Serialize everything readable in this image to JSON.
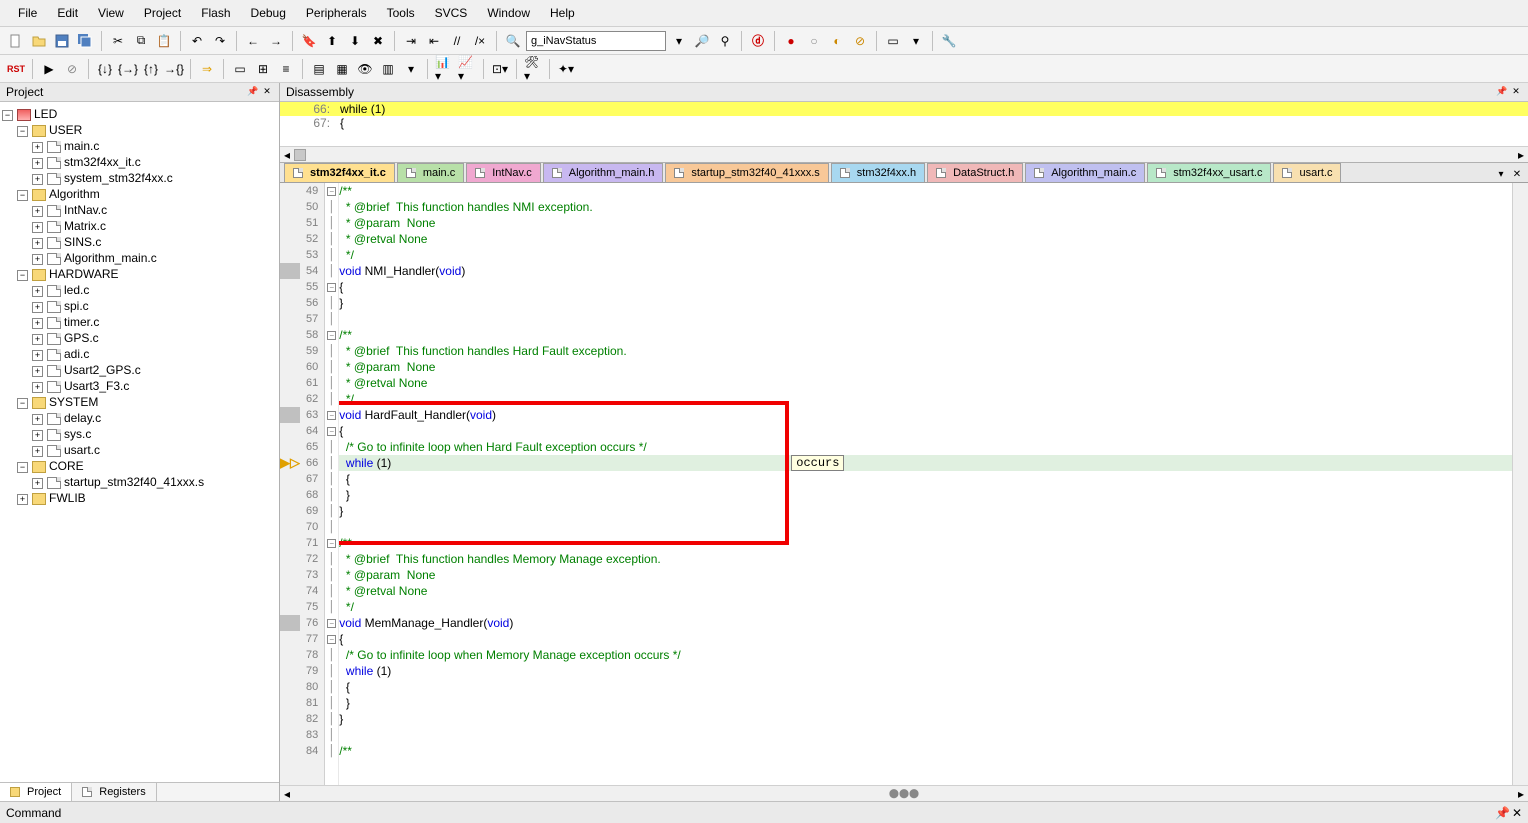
{
  "menubar": [
    "File",
    "Edit",
    "View",
    "Project",
    "Flash",
    "Debug",
    "Peripherals",
    "Tools",
    "SVCS",
    "Window",
    "Help"
  ],
  "search_value": "g_iNavStatus",
  "panes": {
    "project_title": "Project",
    "disasm_title": "Disassembly",
    "command_title": "Command"
  },
  "bottom_tabs": [
    {
      "label": "Project",
      "active": true
    },
    {
      "label": "Registers",
      "active": false
    }
  ],
  "tree": {
    "root": "LED",
    "groups": [
      {
        "name": "USER",
        "files": [
          "main.c",
          "stm32f4xx_it.c",
          "system_stm32f4xx.c"
        ]
      },
      {
        "name": "Algorithm",
        "files": [
          "IntNav.c",
          "Matrix.c",
          "SINS.c",
          "Algorithm_main.c"
        ]
      },
      {
        "name": "HARDWARE",
        "files": [
          "led.c",
          "spi.c",
          "timer.c",
          "GPS.c",
          "adi.c",
          "Usart2_GPS.c",
          "Usart3_F3.c"
        ]
      },
      {
        "name": "SYSTEM",
        "files": [
          "delay.c",
          "sys.c",
          "usart.c"
        ]
      },
      {
        "name": "CORE",
        "files": [
          "startup_stm32f40_41xxx.s"
        ]
      },
      {
        "name": "FWLIB",
        "files": []
      }
    ]
  },
  "disasm": [
    {
      "num": "66:",
      "text": "   while (1)",
      "hl": true
    },
    {
      "num": "67:",
      "text": "   {",
      "hl": false
    }
  ],
  "editor_tabs": [
    {
      "label": "stm32f4xx_it.c",
      "cls": "c0",
      "active": true
    },
    {
      "label": "main.c",
      "cls": "c1",
      "active": false
    },
    {
      "label": "IntNav.c",
      "cls": "c2",
      "active": false
    },
    {
      "label": "Algorithm_main.h",
      "cls": "c3",
      "active": false
    },
    {
      "label": "startup_stm32f40_41xxx.s",
      "cls": "c4",
      "active": false
    },
    {
      "label": "stm32f4xx.h",
      "cls": "c5",
      "active": false
    },
    {
      "label": "DataStruct.h",
      "cls": "c6",
      "active": false
    },
    {
      "label": "Algorithm_main.c",
      "cls": "c7",
      "active": false
    },
    {
      "label": "stm32f4xx_usart.c",
      "cls": "c8",
      "active": false
    },
    {
      "label": "usart.c",
      "cls": "c9",
      "active": false
    }
  ],
  "tooltip": "occurs",
  "code": {
    "start": 49,
    "current_line": 66,
    "breakpoint_lines": [
      54,
      63,
      76
    ],
    "fold_minus": [
      49,
      55,
      58,
      63,
      64,
      71,
      76,
      77
    ],
    "lines": [
      {
        "n": 49,
        "html": "<span class='cm'>/**</span>"
      },
      {
        "n": 50,
        "html": "<span class='cm'>  * @brief  This function handles NMI exception.</span>"
      },
      {
        "n": 51,
        "html": "<span class='cm'>  * @param  None</span>"
      },
      {
        "n": 52,
        "html": "<span class='cm'>  * @retval None</span>"
      },
      {
        "n": 53,
        "html": "<span class='cm'>  */</span>"
      },
      {
        "n": 54,
        "html": "<span class='kw'>void</span> NMI_Handler(<span class='kw'>void</span>)"
      },
      {
        "n": 55,
        "html": "{"
      },
      {
        "n": 56,
        "html": "}"
      },
      {
        "n": 57,
        "html": ""
      },
      {
        "n": 58,
        "html": "<span class='cm'>/**</span>"
      },
      {
        "n": 59,
        "html": "<span class='cm'>  * @brief  This function handles Hard Fault exception.</span>"
      },
      {
        "n": 60,
        "html": "<span class='cm'>  * @param  None</span>"
      },
      {
        "n": 61,
        "html": "<span class='cm'>  * @retval None</span>"
      },
      {
        "n": 62,
        "html": "<span class='cm'>  */</span>"
      },
      {
        "n": 63,
        "html": "<span class='kw'>void</span> HardFault_Handler(<span class='kw'>void</span>)"
      },
      {
        "n": 64,
        "html": "{"
      },
      {
        "n": 65,
        "html": "  <span class='cm'>/* Go to infinite loop when Hard Fault exception occurs */</span>"
      },
      {
        "n": 66,
        "html": "  <span class='kw'>while</span> (1)",
        "hl": true
      },
      {
        "n": 67,
        "html": "  {"
      },
      {
        "n": 68,
        "html": "  }"
      },
      {
        "n": 69,
        "html": "}"
      },
      {
        "n": 70,
        "html": ""
      },
      {
        "n": 71,
        "html": "<span class='cm'>/**</span>"
      },
      {
        "n": 72,
        "html": "<span class='cm'>  * @brief  This function handles Memory Manage exception.</span>"
      },
      {
        "n": 73,
        "html": "<span class='cm'>  * @param  None</span>"
      },
      {
        "n": 74,
        "html": "<span class='cm'>  * @retval None</span>"
      },
      {
        "n": 75,
        "html": "<span class='cm'>  */</span>"
      },
      {
        "n": 76,
        "html": "<span class='kw'>void</span> MemManage_Handler(<span class='kw'>void</span>)"
      },
      {
        "n": 77,
        "html": "{"
      },
      {
        "n": 78,
        "html": "  <span class='cm'>/* Go to infinite loop when Memory Manage exception occurs */</span>"
      },
      {
        "n": 79,
        "html": "  <span class='kw'>while</span> (1)"
      },
      {
        "n": 80,
        "html": "  {"
      },
      {
        "n": 81,
        "html": "  }"
      },
      {
        "n": 82,
        "html": "}"
      },
      {
        "n": 83,
        "html": ""
      },
      {
        "n": 84,
        "html": "<span class='cm'>/**</span>"
      }
    ]
  }
}
